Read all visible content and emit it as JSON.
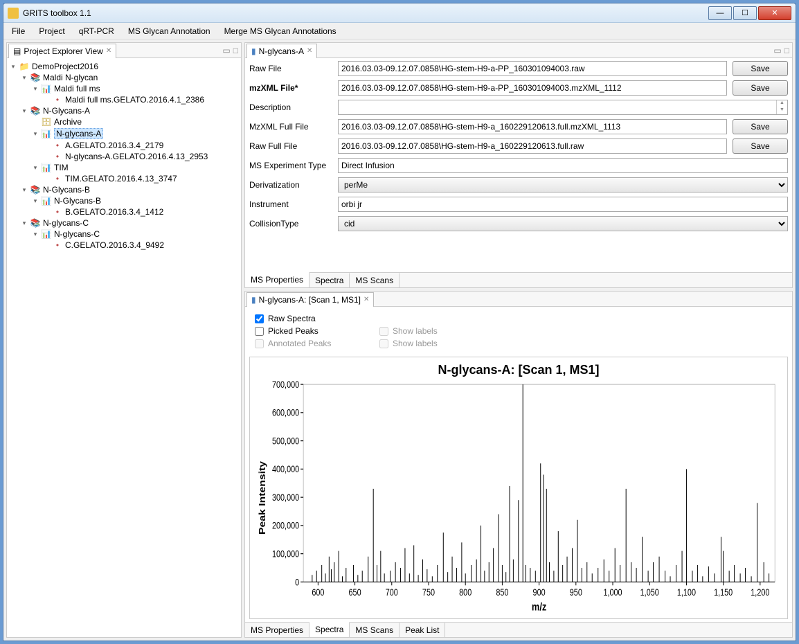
{
  "window": {
    "title": "GRITS toolbox 1.1"
  },
  "menu": [
    "File",
    "Project",
    "qRT-PCR",
    "MS Glycan Annotation",
    "Merge MS Glycan Annotations"
  ],
  "explorer": {
    "title": "Project Explorer View",
    "tree": [
      {
        "l": 0,
        "exp": true,
        "ic": "proj",
        "t": "DemoProject2016"
      },
      {
        "l": 1,
        "exp": true,
        "ic": "fold",
        "t": "Maldi N-glycan"
      },
      {
        "l": 2,
        "exp": true,
        "ic": "chart",
        "t": "Maldi full ms"
      },
      {
        "l": 3,
        "exp": null,
        "ic": "node",
        "t": "Maldi full ms.GELATO.2016.4.1_2386"
      },
      {
        "l": 1,
        "exp": true,
        "ic": "fold",
        "t": "N-Glycans-A"
      },
      {
        "l": 2,
        "exp": null,
        "ic": "arc",
        "t": "Archive"
      },
      {
        "l": 2,
        "exp": true,
        "ic": "chart",
        "t": "N-glycans-A",
        "sel": true
      },
      {
        "l": 3,
        "exp": null,
        "ic": "node",
        "t": "A.GELATO.2016.3.4_2179"
      },
      {
        "l": 3,
        "exp": null,
        "ic": "node",
        "t": "N-glycans-A.GELATO.2016.4.13_2953"
      },
      {
        "l": 2,
        "exp": true,
        "ic": "chart",
        "t": "TIM"
      },
      {
        "l": 3,
        "exp": null,
        "ic": "node",
        "t": "TIM.GELATO.2016.4.13_3747"
      },
      {
        "l": 1,
        "exp": true,
        "ic": "fold",
        "t": "N-Glycans-B"
      },
      {
        "l": 2,
        "exp": true,
        "ic": "chart",
        "t": "N-Glycans-B"
      },
      {
        "l": 3,
        "exp": null,
        "ic": "node",
        "t": "B.GELATO.2016.3.4_1412"
      },
      {
        "l": 1,
        "exp": true,
        "ic": "fold",
        "t": "N-glycans-C"
      },
      {
        "l": 2,
        "exp": true,
        "ic": "chart",
        "t": "N-glycans-C"
      },
      {
        "l": 3,
        "exp": null,
        "ic": "node",
        "t": "C.GELATO.2016.3.4_9492"
      }
    ]
  },
  "editor": {
    "tab": "N-glycans-A",
    "fields": {
      "rawfile": {
        "label": "Raw File",
        "value": "2016.03.03-09.12.07.0858\\HG-stem-H9-a-PP_160301094003.raw",
        "save": "Save"
      },
      "mzxml": {
        "label": "mzXML File*",
        "value": "2016.03.03-09.12.07.0858\\HG-stem-H9-a-PP_160301094003.mzXML_1112",
        "save": "Save"
      },
      "desc": {
        "label": "Description",
        "value": ""
      },
      "mzfull": {
        "label": "MzXML Full File",
        "value": "2016.03.03-09.12.07.0858\\HG-stem-H9-a_160229120613.full.mzXML_1113",
        "save": "Save"
      },
      "rawfull": {
        "label": "Raw Full File",
        "value": "2016.03.03-09.12.07.0858\\HG-stem-H9-a_160229120613.full.raw",
        "save": "Save"
      },
      "mstype": {
        "label": "MS Experiment Type",
        "value": "Direct Infusion"
      },
      "deriv": {
        "label": "Derivatization",
        "value": "perMe"
      },
      "instr": {
        "label": "Instrument",
        "value": "orbi jr"
      },
      "coll": {
        "label": "CollisionType",
        "value": "cid"
      }
    },
    "subtabs": [
      "MS Properties",
      "Spectra",
      "MS Scans"
    ]
  },
  "spectra": {
    "tab": "N-glycans-A: [Scan 1, MS1]",
    "opts": {
      "raw": "Raw Spectra",
      "picked": "Picked Peaks",
      "annot": "Annotated Peaks",
      "show": "Show labels"
    },
    "subtabs": [
      "MS Properties",
      "Spectra",
      "MS Scans",
      "Peak List"
    ]
  },
  "chart_data": {
    "type": "bar",
    "title": "N-glycans-A: [Scan 1, MS1]",
    "xlabel": "m/z",
    "ylabel": "Peak Intensity",
    "xlim": [
      580,
      1220
    ],
    "ylim": [
      0,
      700000
    ],
    "xticks": [
      600,
      650,
      700,
      750,
      800,
      850,
      900,
      950,
      1000,
      1050,
      1100,
      1150,
      1200
    ],
    "yticks": [
      0,
      100000,
      200000,
      300000,
      400000,
      500000,
      600000,
      700000
    ],
    "yticklabels": [
      "0",
      "100,000",
      "200,000",
      "300,000",
      "400,000",
      "500,000",
      "600,000",
      "700,000"
    ],
    "series": [
      {
        "name": "intensity",
        "x_y": [
          [
            592,
            25000
          ],
          [
            598,
            40000
          ],
          [
            605,
            60000
          ],
          [
            610,
            30000
          ],
          [
            615,
            90000
          ],
          [
            618,
            45000
          ],
          [
            622,
            70000
          ],
          [
            628,
            110000
          ],
          [
            633,
            20000
          ],
          [
            638,
            50000
          ],
          [
            648,
            60000
          ],
          [
            654,
            25000
          ],
          [
            660,
            40000
          ],
          [
            668,
            90000
          ],
          [
            675,
            330000
          ],
          [
            680,
            60000
          ],
          [
            685,
            110000
          ],
          [
            690,
            30000
          ],
          [
            698,
            40000
          ],
          [
            705,
            70000
          ],
          [
            712,
            50000
          ],
          [
            718,
            120000
          ],
          [
            724,
            30000
          ],
          [
            730,
            130000
          ],
          [
            736,
            25000
          ],
          [
            742,
            80000
          ],
          [
            748,
            45000
          ],
          [
            755,
            20000
          ],
          [
            762,
            60000
          ],
          [
            770,
            175000
          ],
          [
            776,
            35000
          ],
          [
            782,
            90000
          ],
          [
            788,
            50000
          ],
          [
            795,
            140000
          ],
          [
            800,
            30000
          ],
          [
            808,
            60000
          ],
          [
            815,
            80000
          ],
          [
            821,
            200000
          ],
          [
            826,
            40000
          ],
          [
            832,
            70000
          ],
          [
            838,
            120000
          ],
          [
            845,
            240000
          ],
          [
            850,
            60000
          ],
          [
            855,
            35000
          ],
          [
            860,
            340000
          ],
          [
            865,
            80000
          ],
          [
            872,
            290000
          ],
          [
            878,
            700000
          ],
          [
            882,
            60000
          ],
          [
            888,
            50000
          ],
          [
            895,
            40000
          ],
          [
            902,
            420000
          ],
          [
            906,
            380000
          ],
          [
            910,
            330000
          ],
          [
            914,
            70000
          ],
          [
            920,
            40000
          ],
          [
            926,
            180000
          ],
          [
            932,
            60000
          ],
          [
            938,
            90000
          ],
          [
            945,
            120000
          ],
          [
            952,
            220000
          ],
          [
            958,
            50000
          ],
          [
            965,
            70000
          ],
          [
            972,
            30000
          ],
          [
            980,
            50000
          ],
          [
            988,
            80000
          ],
          [
            995,
            40000
          ],
          [
            1003,
            120000
          ],
          [
            1010,
            60000
          ],
          [
            1018,
            330000
          ],
          [
            1025,
            70000
          ],
          [
            1032,
            50000
          ],
          [
            1040,
            160000
          ],
          [
            1048,
            40000
          ],
          [
            1055,
            70000
          ],
          [
            1063,
            90000
          ],
          [
            1071,
            40000
          ],
          [
            1078,
            20000
          ],
          [
            1086,
            60000
          ],
          [
            1094,
            110000
          ],
          [
            1100,
            400000
          ],
          [
            1108,
            40000
          ],
          [
            1115,
            60000
          ],
          [
            1122,
            20000
          ],
          [
            1130,
            55000
          ],
          [
            1138,
            30000
          ],
          [
            1147,
            160000
          ],
          [
            1150,
            110000
          ],
          [
            1158,
            40000
          ],
          [
            1165,
            60000
          ],
          [
            1173,
            30000
          ],
          [
            1180,
            50000
          ],
          [
            1188,
            20000
          ],
          [
            1196,
            280000
          ],
          [
            1205,
            70000
          ],
          [
            1212,
            30000
          ]
        ]
      }
    ]
  }
}
